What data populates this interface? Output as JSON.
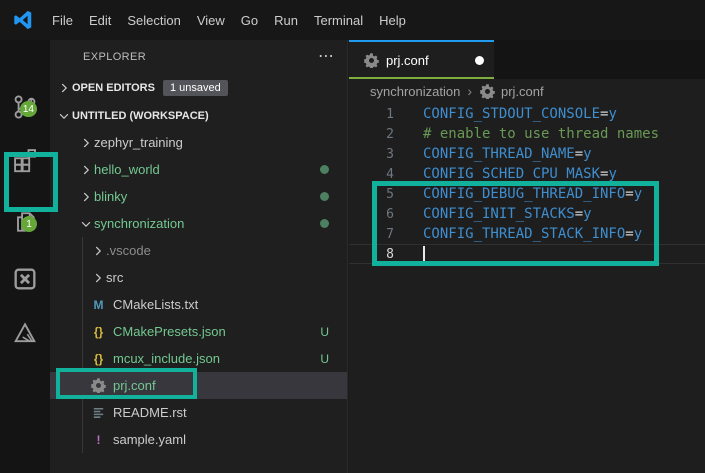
{
  "title_bar": {
    "menus": [
      "File",
      "Edit",
      "Selection",
      "View",
      "Go",
      "Run",
      "Terminal",
      "Help"
    ]
  },
  "activity_bar": {
    "badge_color": "#65a839",
    "items": [
      {
        "name": "source-control",
        "icon": "source-control-icon",
        "badge": "14"
      },
      {
        "name": "extensions",
        "icon": "extensions-icon"
      },
      {
        "name": "explorer",
        "icon": "explorer-files-icon",
        "badge": "1",
        "annotated": true
      },
      {
        "name": "x-extension",
        "icon": "boxed-x-icon"
      },
      {
        "name": "build-tools",
        "icon": "triangle-wrench-icon"
      }
    ]
  },
  "sidebar": {
    "title": "EXPLORER",
    "sections": [
      {
        "label": "OPEN EDITORS",
        "collapsed": true,
        "badge": "1 unsaved"
      },
      {
        "label": "UNTITLED (WORKSPACE)",
        "collapsed": false
      }
    ],
    "tree": [
      {
        "label": "zephyr_training",
        "type": "folder",
        "level": 1,
        "color": "default"
      },
      {
        "label": "hello_world",
        "type": "folder",
        "level": 1,
        "color": "green",
        "dot": true
      },
      {
        "label": "blinky",
        "type": "folder",
        "level": 1,
        "color": "green",
        "dot": true
      },
      {
        "label": "synchronization",
        "type": "folder",
        "level": 1,
        "color": "green",
        "dot": true,
        "expanded": true
      },
      {
        "label": ".vscode",
        "type": "folder",
        "level": 2,
        "color": "dim"
      },
      {
        "label": "src",
        "type": "folder",
        "level": 2,
        "color": "default"
      },
      {
        "label": "CMakeLists.txt",
        "type": "file",
        "icon": "cmake-icon",
        "level": 2,
        "color": "default"
      },
      {
        "label": "CMakePresets.json",
        "type": "file",
        "icon": "json-icon",
        "level": 2,
        "color": "green",
        "badge": "U"
      },
      {
        "label": "mcux_include.json",
        "type": "file",
        "icon": "json-icon",
        "level": 2,
        "color": "green",
        "badge": "U"
      },
      {
        "label": "prj.conf",
        "type": "file",
        "icon": "gear-icon",
        "level": 2,
        "color": "green",
        "selected": true,
        "annotated": true
      },
      {
        "label": "README.rst",
        "type": "file",
        "icon": "readme-lines-icon",
        "level": 2,
        "color": "default"
      },
      {
        "label": "sample.yaml",
        "type": "file",
        "icon": "yaml-bang-icon",
        "level": 2,
        "color": "default"
      }
    ],
    "file_colors": {
      "default": "#cccccc",
      "green": "#73c991",
      "dim": "#8c8c8c"
    }
  },
  "editor": {
    "tab": {
      "label": "prj.conf",
      "icon": "gear-icon",
      "modified": true,
      "top_border_color": "#1f9cf0",
      "underline_color": "#7fae3f"
    },
    "breadcrumb": [
      {
        "label": "synchronization"
      },
      {
        "label": "prj.conf",
        "icon": "gear-icon"
      }
    ],
    "token_colors": {
      "ident": "#3e8ed0",
      "op": "#d4d4d4",
      "val": "#3e8ed0",
      "comment": "#6a9955"
    },
    "lines": [
      {
        "num": "1",
        "tokens": [
          [
            "CONFIG_STDOUT_CONSOLE",
            "ident"
          ],
          [
            "=",
            "op"
          ],
          [
            "y",
            "val"
          ]
        ]
      },
      {
        "num": "2",
        "tokens": [
          [
            "# enable to use thread names",
            "comment"
          ]
        ]
      },
      {
        "num": "3",
        "tokens": [
          [
            "CONFIG_THREAD_NAME",
            "ident"
          ],
          [
            "=",
            "op"
          ],
          [
            "y",
            "val"
          ]
        ]
      },
      {
        "num": "4",
        "tokens": [
          [
            "CONFIG_SCHED_CPU_MASK",
            "ident"
          ],
          [
            "=",
            "op"
          ],
          [
            "y",
            "val"
          ]
        ]
      },
      {
        "num": "5",
        "tokens": [
          [
            "CONFIG_DEBUG_THREAD_INFO",
            "ident"
          ],
          [
            "=",
            "op"
          ],
          [
            "y",
            "val"
          ]
        ]
      },
      {
        "num": "6",
        "tokens": [
          [
            "CONFIG_INIT_STACKS",
            "ident"
          ],
          [
            "=",
            "op"
          ],
          [
            "y",
            "val"
          ]
        ]
      },
      {
        "num": "7",
        "tokens": [
          [
            "CONFIG_THREAD_STACK_INFO",
            "ident"
          ],
          [
            "=",
            "op"
          ],
          [
            "y",
            "val"
          ]
        ]
      },
      {
        "num": "8",
        "tokens": [],
        "cursor": true,
        "active": true
      }
    ]
  },
  "annotations": {
    "color": "#12b19c",
    "boxes": [
      "explorer-activity-icon",
      "prj-conf-tree-item",
      "code-lines-5-to-8"
    ]
  }
}
